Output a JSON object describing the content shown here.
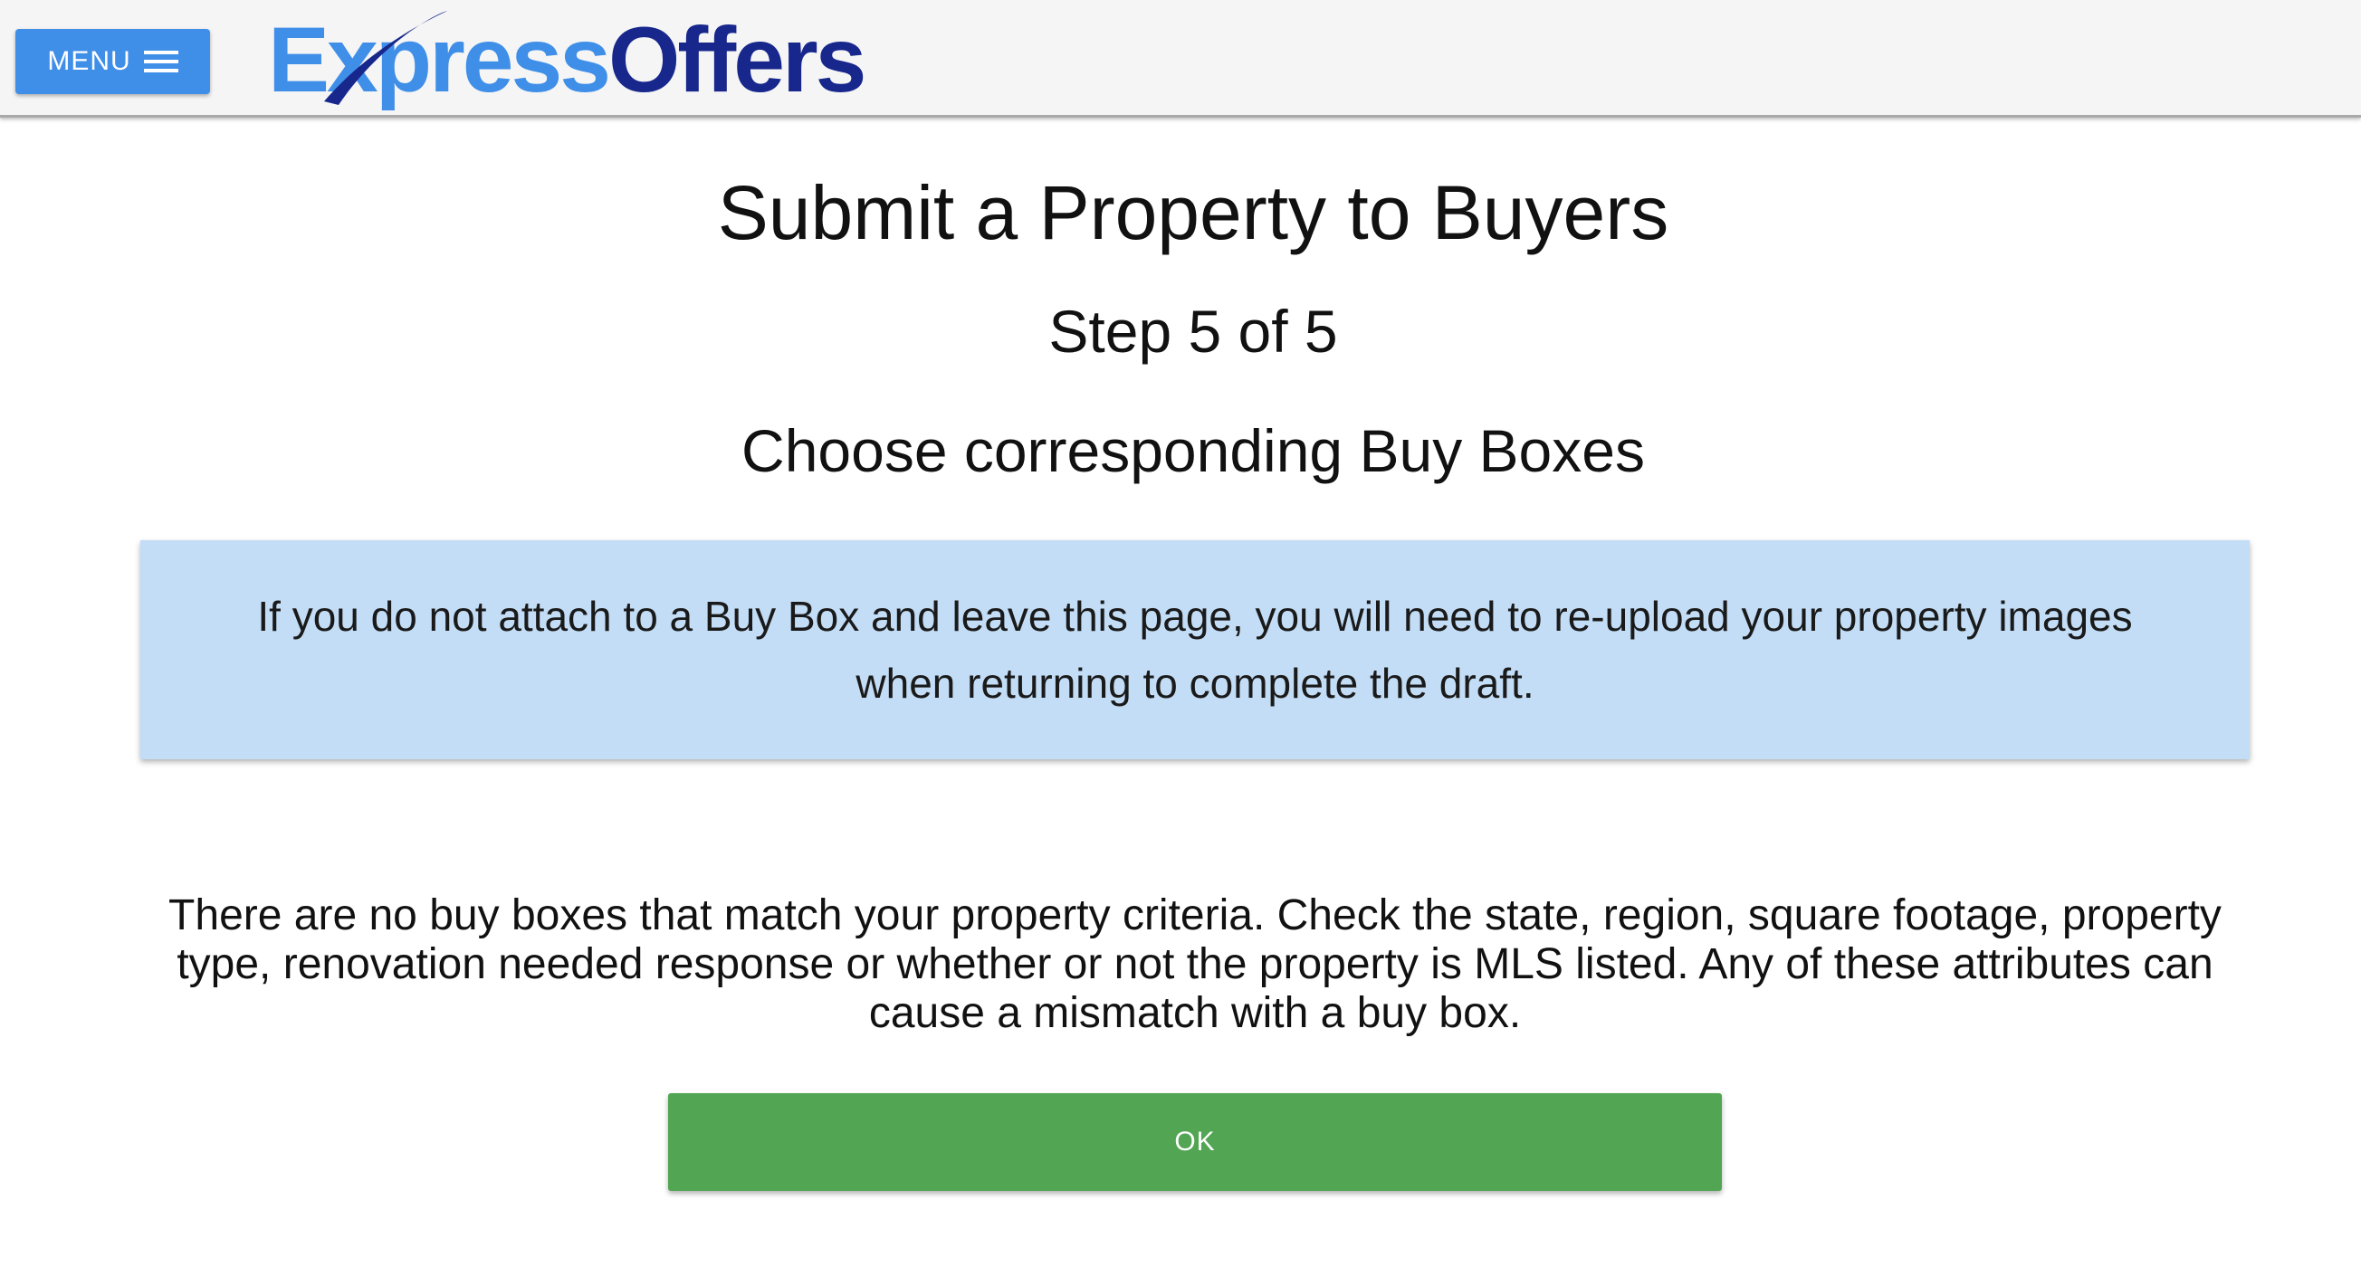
{
  "header": {
    "menu_label": "MENU",
    "menu_icon": "hamburger-icon",
    "logo": {
      "part1": "Express",
      "part2": "Offers",
      "color1": "#3f8ee8",
      "color2": "#17278c"
    }
  },
  "main": {
    "title": "Submit a Property to Buyers",
    "step": "Step 5 of 5",
    "subtitle": "Choose corresponding Buy Boxes",
    "notice": "If you do not attach to a Buy Box and leave this page, you will need to re-upload your property images when returning to complete the draft.",
    "no_match_message": "There are no buy boxes that match your property criteria. Check the state, region, square footage, property type, renovation needed response or whether or not the property is MLS listed. Any of these attributes can cause a mismatch with a buy box.",
    "ok_label": "OK"
  },
  "colors": {
    "menu_button": "#3f8ee8",
    "notice_background": "#c3ddf6",
    "ok_button": "#52a552"
  }
}
